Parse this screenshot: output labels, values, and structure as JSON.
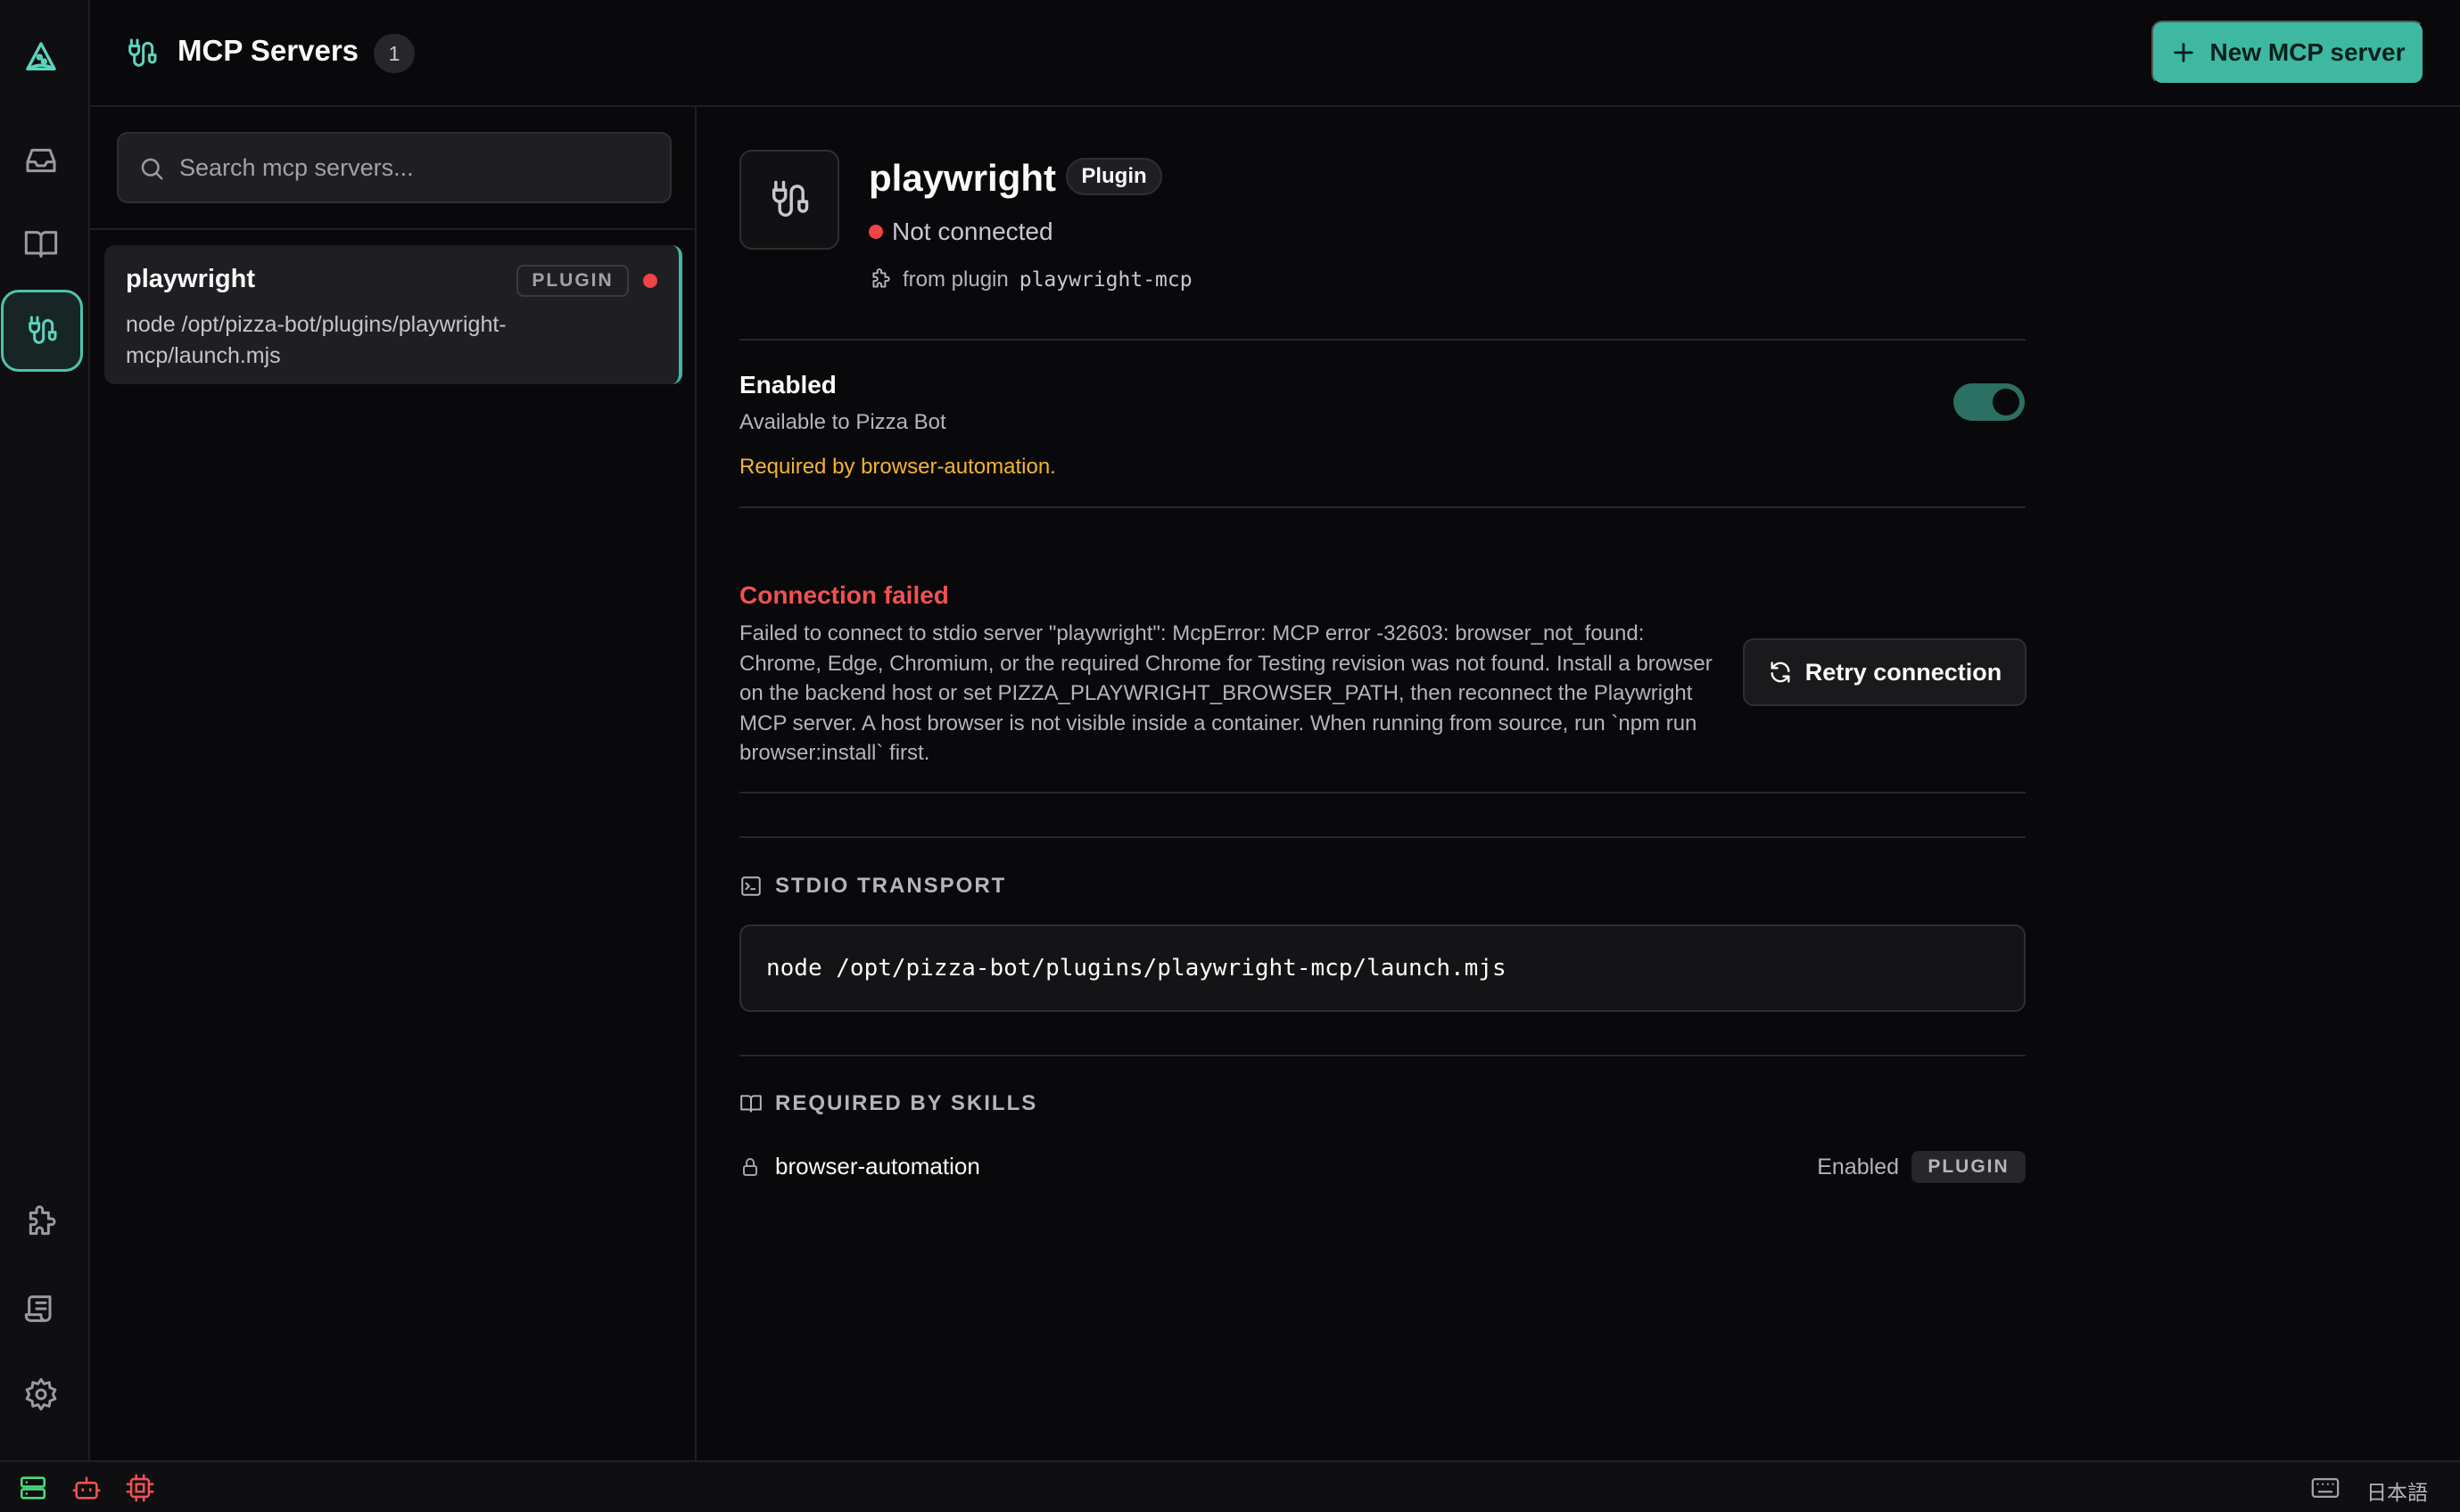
{
  "header": {
    "title": "MCP Servers",
    "count": "1",
    "new_button_label": "New MCP server"
  },
  "search": {
    "placeholder": "Search mcp servers...",
    "value": ""
  },
  "servers": [
    {
      "name": "playwright",
      "badge": "PLUGIN",
      "command": "node /opt/pizza-bot/plugins/playwright-mcp/launch.mjs",
      "status_color": "#ef4444"
    }
  ],
  "detail": {
    "name": "playwright",
    "badge": "Plugin",
    "status": "Not connected",
    "source_prefix": "from plugin",
    "source_plugin": "playwright-mcp",
    "enabled": {
      "title": "Enabled",
      "subtitle": "Available to Pizza Bot",
      "required_note": "Required by browser-automation.",
      "on": true
    },
    "error": {
      "title": "Connection failed",
      "message": "Failed to connect to stdio server \"playwright\": McpError: MCP error -32603: browser_not_found: Chrome, Edge, Chromium, or the required Chrome for Testing revision was not found. Install a browser on the backend host or set PIZZA_PLAYWRIGHT_BROWSER_PATH, then reconnect the Playwright MCP server. A host browser is not visible inside a container. When running from source, run `npm run browser:install` first.",
      "retry_label": "Retry connection"
    },
    "transport": {
      "label": "STDIO TRANSPORT",
      "command": "node /opt/pizza-bot/plugins/playwright-mcp/launch.mjs"
    },
    "skills": {
      "label": "REQUIRED BY SKILLS",
      "items": [
        {
          "name": "browser-automation",
          "status": "Enabled",
          "badge": "PLUGIN"
        }
      ]
    }
  },
  "statusbar": {
    "language": "日本語"
  },
  "colors": {
    "accent": "#3fb8a2",
    "error": "#f05252",
    "warning": "#f5b335",
    "background": "#09090b"
  },
  "icons": {
    "rail": [
      "pizza-logo-icon",
      "inbox-icon",
      "book-icon",
      "plug-icon",
      "puzzle-icon",
      "scroll-icon",
      "gear-icon"
    ],
    "statusbar": [
      "server-icon",
      "bot-icon",
      "cpu-icon",
      "keyboard-icon"
    ]
  }
}
